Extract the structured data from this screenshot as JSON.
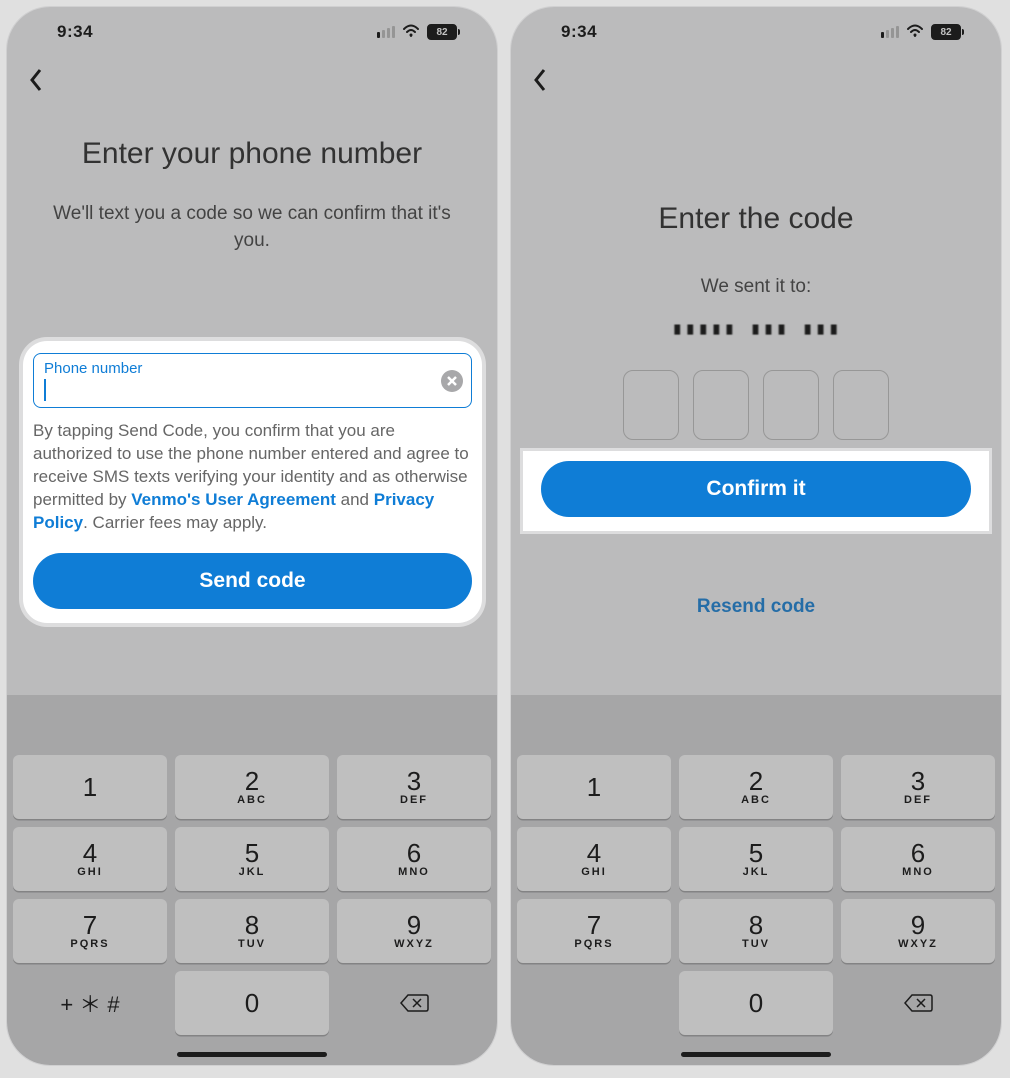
{
  "status": {
    "time": "9:34",
    "battery": "82"
  },
  "left": {
    "title": "Enter your phone number",
    "subtitle": "We'll text you a code so we can confirm that it's you.",
    "input_label": "Phone number",
    "input_value": "",
    "disclaimer_1": "By tapping Send Code, you confirm that you are authorized to use the phone number entered and agree to receive SMS texts verifying your identity and as otherwise permitted by ",
    "link_user_agreement": "Venmo's User Agreement",
    "disclaimer_2": " and ",
    "link_privacy": "Privacy Policy",
    "disclaimer_3": ". Carrier fees may apply.",
    "send_button": "Send code"
  },
  "right": {
    "title": "Enter the code",
    "sent_to_label": "We sent it to:",
    "sent_to_value": "▮▮▮▮▮ ▮▮▮ ▮▮▮",
    "confirm_button": "Confirm it",
    "resend_link": "Resend code"
  },
  "keypad": {
    "keys": [
      {
        "d": "1",
        "l": ""
      },
      {
        "d": "2",
        "l": "ABC"
      },
      {
        "d": "3",
        "l": "DEF"
      },
      {
        "d": "4",
        "l": "GHI"
      },
      {
        "d": "5",
        "l": "JKL"
      },
      {
        "d": "6",
        "l": "MNO"
      },
      {
        "d": "7",
        "l": "PQRS"
      },
      {
        "d": "8",
        "l": "TUV"
      },
      {
        "d": "9",
        "l": "WXYZ"
      }
    ],
    "special": "+ ＊ #",
    "zero": "0"
  }
}
